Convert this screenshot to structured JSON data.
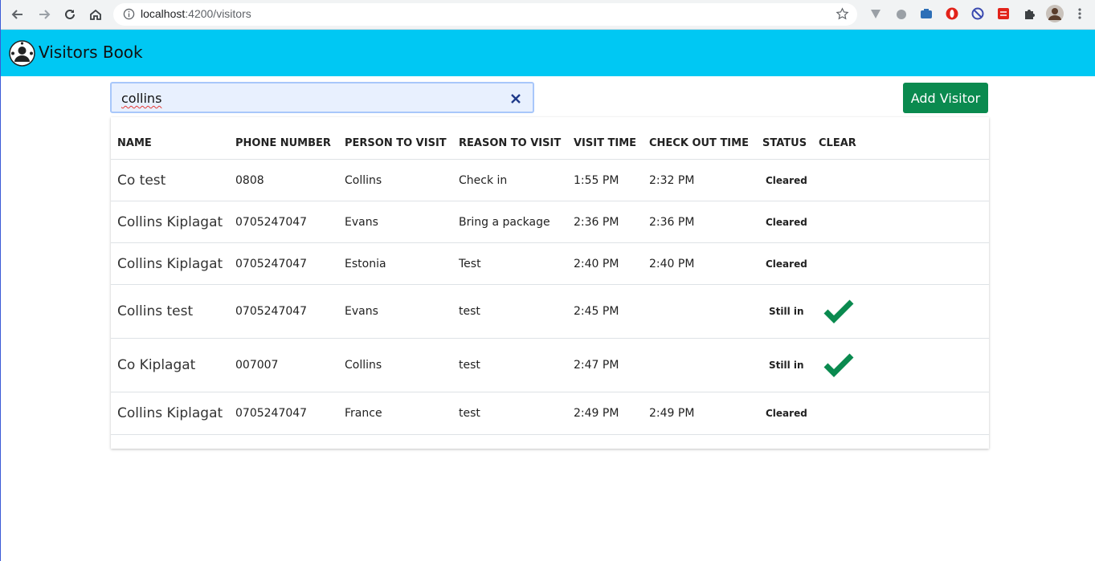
{
  "browser": {
    "url_host": "localhost",
    "url_path": ":4200/visitors"
  },
  "app": {
    "title": "Visitors Book"
  },
  "search": {
    "value": "collins"
  },
  "actions": {
    "add_visitor": "Add Visitor"
  },
  "table": {
    "headers": {
      "name": "NAME",
      "phone": "PHONE NUMBER",
      "person": "PERSON TO VISIT",
      "reason": "REASON TO VISIT",
      "visit_time": "VISIT TIME",
      "checkout": "CHECK OUT TIME",
      "status": "STATUS",
      "clear": "CLEAR"
    },
    "rows": [
      {
        "name": "Co test",
        "phone": "0808",
        "person": "Collins",
        "reason": "Check in",
        "visit_time": "1:55 PM",
        "checkout": "2:32 PM",
        "status": "Cleared",
        "clear": false
      },
      {
        "name": "Collins Kiplagat",
        "phone": "0705247047",
        "person": "Evans",
        "reason": "Bring a package",
        "visit_time": "2:36 PM",
        "checkout": "2:36 PM",
        "status": "Cleared",
        "clear": false
      },
      {
        "name": "Collins Kiplagat",
        "phone": "0705247047",
        "person": "Estonia",
        "reason": "Test",
        "visit_time": "2:40 PM",
        "checkout": "2:40 PM",
        "status": "Cleared",
        "clear": false
      },
      {
        "name": "Collins test",
        "phone": "0705247047",
        "person": "Evans",
        "reason": "test",
        "visit_time": "2:45 PM",
        "checkout": "",
        "status": "Still in",
        "clear": true
      },
      {
        "name": "Co Kiplagat",
        "phone": "007007",
        "person": "Collins",
        "reason": "test",
        "visit_time": "2:47 PM",
        "checkout": "",
        "status": "Still in",
        "clear": true
      },
      {
        "name": "Collins Kiplagat",
        "phone": "0705247047",
        "person": "France",
        "reason": "test",
        "visit_time": "2:49 PM",
        "checkout": "2:49 PM",
        "status": "Cleared",
        "clear": false
      }
    ]
  },
  "colors": {
    "appbar": "#00c8f3",
    "add_button": "#0a8a4f",
    "check": "#0a8a4f"
  },
  "icons": [
    "back-icon",
    "forward-icon",
    "reload-icon",
    "home-icon",
    "info-icon",
    "star-icon",
    "close-icon",
    "check-icon",
    "logo-icon"
  ]
}
